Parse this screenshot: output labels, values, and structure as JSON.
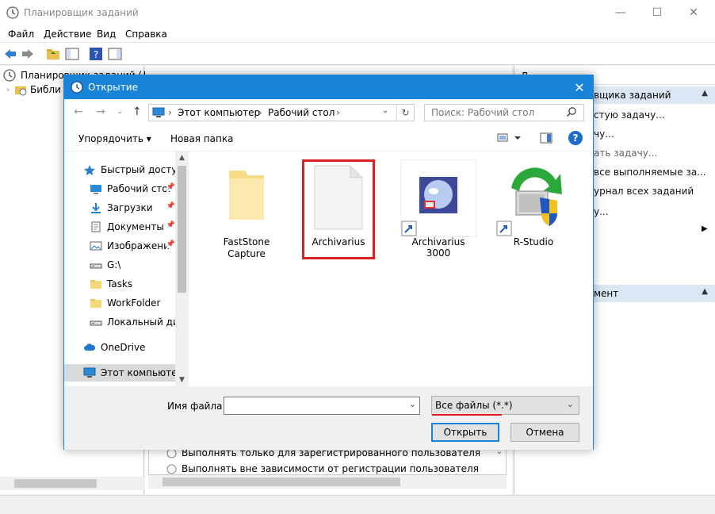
{
  "main_window": {
    "title": "Планировщик заданий",
    "controls": {
      "minimize": "—",
      "maximize": "☐",
      "close": "✕"
    },
    "menu": [
      "Файл",
      "Действие",
      "Вид",
      "Справка"
    ],
    "tree": {
      "root": "Планировщик заданий (Ло",
      "child": "Библи"
    },
    "actions": {
      "header_partial": "Д",
      "section1_header": "вщика заданий",
      "items": [
        "стую задачу...",
        "чу...",
        "ать задачу...",
        "все выполняемые за...",
        "урнал всех заданий",
        "у..."
      ],
      "section2_header": "мент"
    },
    "options": [
      "Выполнять только для зарегистрированного пользователя",
      "Выполнять вне зависимости от регистрации пользователя"
    ]
  },
  "dialog": {
    "title": "Открытие",
    "close": "✕",
    "breadcrumb": [
      "Этот компьютер",
      "Рабочий стол"
    ],
    "search_placeholder": "Поиск: Рабочий стол",
    "organize_label": "Упорядочить ▾",
    "new_folder_label": "Новая папка",
    "help_label": "?",
    "nav_items": [
      {
        "label": "Быстрый доступ",
        "icon": "star-icon"
      },
      {
        "label": "Рабочий сто.",
        "icon": "desktop-icon",
        "pinned": true
      },
      {
        "label": "Загрузки",
        "icon": "download-icon",
        "pinned": true
      },
      {
        "label": "Документы",
        "icon": "documents-icon",
        "pinned": true
      },
      {
        "label": "Изображени",
        "icon": "pictures-icon",
        "pinned": true
      },
      {
        "label": "G:\\",
        "icon": "drive-icon"
      },
      {
        "label": "Tasks",
        "icon": "folder-icon"
      },
      {
        "label": "WorkFolder",
        "icon": "folder-icon"
      },
      {
        "label": "Локальный дис",
        "icon": "drive-icon"
      },
      {
        "label": "OneDrive",
        "icon": "cloud-icon"
      },
      {
        "label": "Этот компьютер",
        "icon": "computer-icon"
      }
    ],
    "files": [
      {
        "name": "FastStone Capture",
        "line1": "FastStone",
        "line2": "Capture",
        "icon": "folder-icon"
      },
      {
        "name": "Archivarius",
        "line1": "Archivarius",
        "line2": "",
        "icon": "blank-file-icon",
        "selected": true
      },
      {
        "name": "Archivarius 3000",
        "line1": "Archivarius 3000",
        "line2": "",
        "icon": "archivarius-shortcut-icon"
      },
      {
        "name": "R-Studio",
        "line1": "R-Studio",
        "line2": "",
        "icon": "rstudio-shortcut-icon"
      }
    ],
    "filename_label": "Имя файла:",
    "filename_value": "",
    "filter_value": "Все файлы (*.*)",
    "open_button": "Открыть",
    "cancel_button": "Отмена",
    "highlight_color": "#e02020",
    "accent_color": "#1883d7"
  }
}
